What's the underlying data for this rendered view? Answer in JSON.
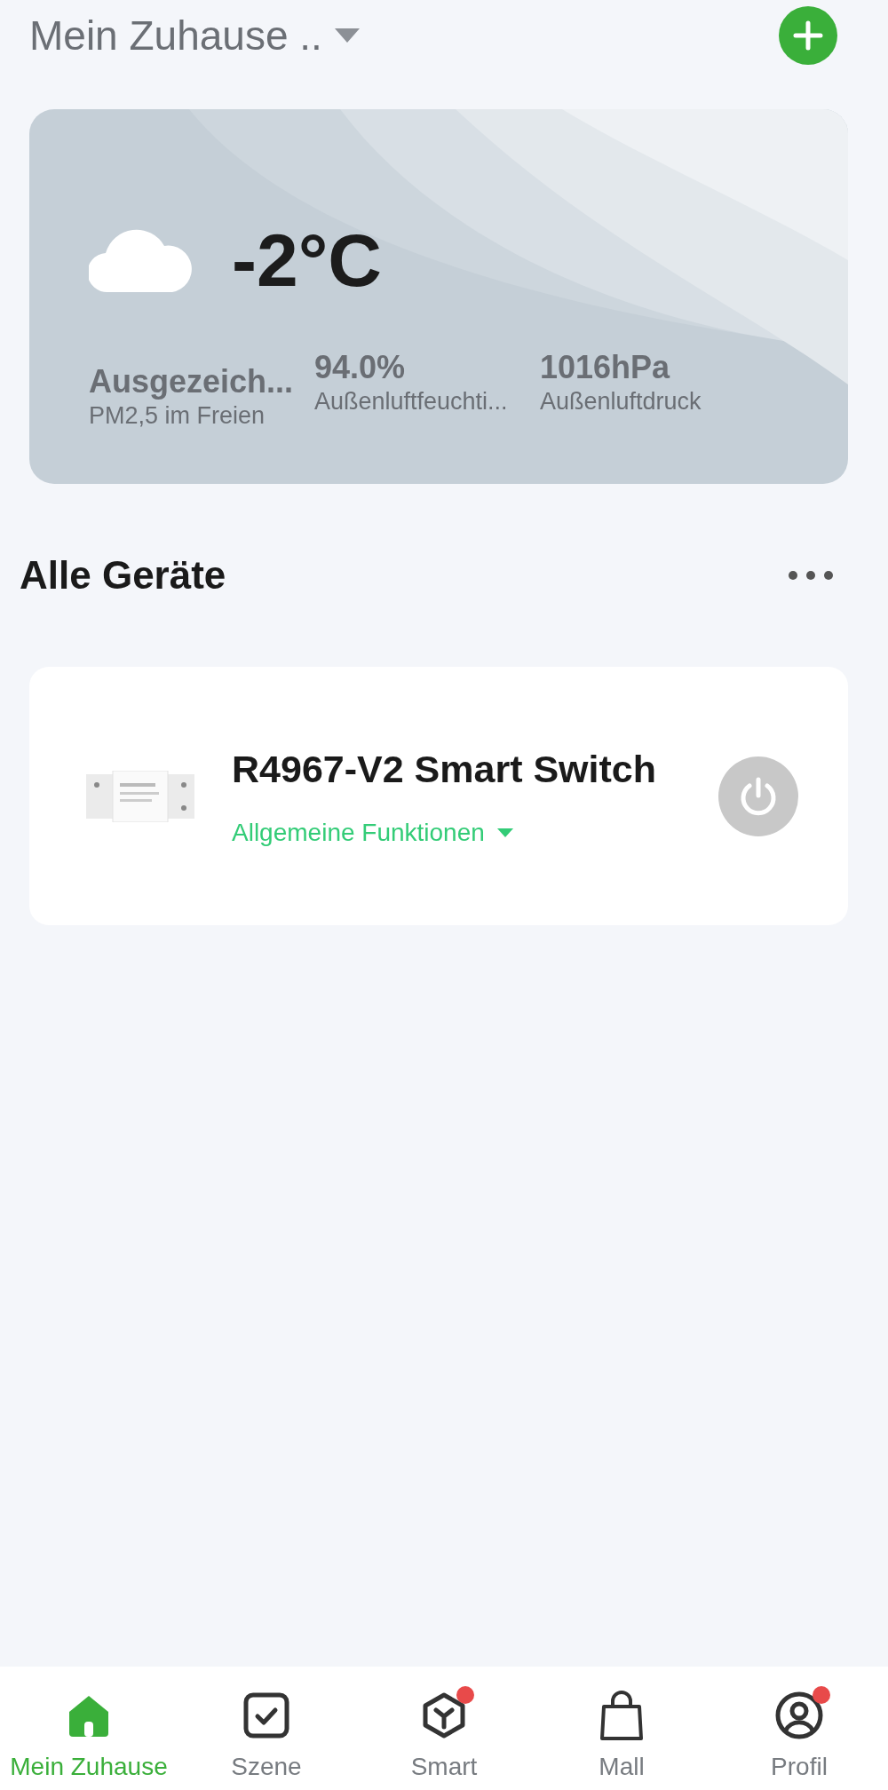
{
  "header": {
    "home_name": "Mein Zuhause .."
  },
  "weather": {
    "temperature": "-2°C",
    "stats": [
      {
        "value": "Ausgezeich...",
        "label": "PM2,5 im Freien"
      },
      {
        "value": "94.0%",
        "label": "Außenluftfeuchti..."
      },
      {
        "value": "1016hPa",
        "label": "Außenluftdruck"
      }
    ]
  },
  "devices_section": {
    "title": "Alle Geräte"
  },
  "devices": [
    {
      "name": "R4967-V2 Smart Switch",
      "function": "Allgemeine Funktionen",
      "on": false
    }
  ],
  "nav": [
    {
      "kind": "home",
      "label": "Mein Zuhause",
      "selected": true,
      "badge": false
    },
    {
      "kind": "scene",
      "label": "Szene",
      "selected": false,
      "badge": false
    },
    {
      "kind": "smart",
      "label": "Smart",
      "selected": false,
      "badge": true
    },
    {
      "kind": "mall",
      "label": "Mall",
      "selected": false,
      "badge": false
    },
    {
      "kind": "profile",
      "label": "Profil",
      "selected": false,
      "badge": true
    }
  ]
}
